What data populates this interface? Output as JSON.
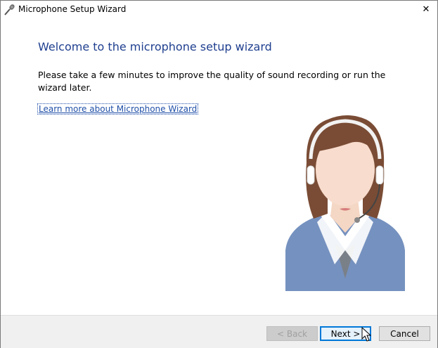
{
  "window": {
    "title": "Microphone Setup Wizard",
    "close_glyph": "✕"
  },
  "content": {
    "heading": "Welcome to the microphone setup wizard",
    "body": "Please take a few minutes to improve the quality of sound recording or run the wizard later.",
    "link": "Learn more about Microphone Wizard"
  },
  "footer": {
    "back_label": "< Back",
    "next_label": "Next >",
    "cancel_label": "Cancel"
  },
  "icons": {
    "app": "microphone-icon",
    "close": "close-icon",
    "illustration": "headset-operator-icon",
    "cursor": "mouse-pointer-icon"
  },
  "colors": {
    "heading": "#1f3f8f",
    "link": "#1f4fa8",
    "default_button_border": "#0078d7"
  }
}
